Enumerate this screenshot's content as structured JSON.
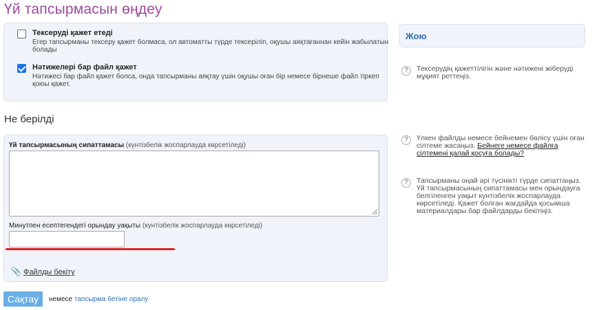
{
  "page": {
    "title": "Үй тапсырмасын өңдеу"
  },
  "options": {
    "review": {
      "title": "Тексеруді қажет етеді",
      "desc": "Егер тапсырманы тексеру қажет болмаса, ол автоматты түрде тексеріліп, оқушы аяқтағаннан кейін жабылатын болады",
      "checked": false
    },
    "file_result": {
      "title": "Нәтижелері бар файл қажет",
      "desc": "Нәтижесі бар файл қажет болса, онда тапсырманы аяқтау үшін оқушы оған бір немесе бірнеше файл тіркеп қоюы қажет.",
      "checked": true
    }
  },
  "section": {
    "heading": "Не берілді"
  },
  "description_field": {
    "label": "Үй тапсырмасының сипаттамасы",
    "hint": "(күнтізбелік жоспарлауда көрсетіледі)",
    "value": ""
  },
  "time_field": {
    "label": "Минутпен есептегендегі орындау уақыты",
    "hint": "(күнтізбелік жоспарлауда көрсетіледі)",
    "value": ""
  },
  "attach": {
    "label": "Файлды бекіту"
  },
  "sidebar": {
    "delete_label": "Жою",
    "help_review": "Тексерудің қажеттілігін және нәтижені жіберуді мұқият реттеңіз.",
    "help_video_text": "Үлкен файлды немесе бейнемен бөлісу үшін оған сілтеме жасаңыз.",
    "help_video_link": "Бейнеге немесе файлға сілтемені қалай қосуға болады?",
    "help_describe": "Тапсырманы оңай әрі түсінікті түрде сипаттаңыз. Үй тапсырмасының сипаттамасы мен орындауға белгіленген уақыт күнтізбелік жоспарлауда көрсетіледі. Қажет болған жағдайда қосымша материалдары бар файлдарды бекітіңіз."
  },
  "footer": {
    "save_label": "Сақтау",
    "or_text": "немесе",
    "back_link": "тапсырма бетіне оралу"
  },
  "colors": {
    "title": "#9c4a9b",
    "accent": "#2d6db5",
    "save_button": "#6aaee6",
    "highlight": "#e02020"
  }
}
